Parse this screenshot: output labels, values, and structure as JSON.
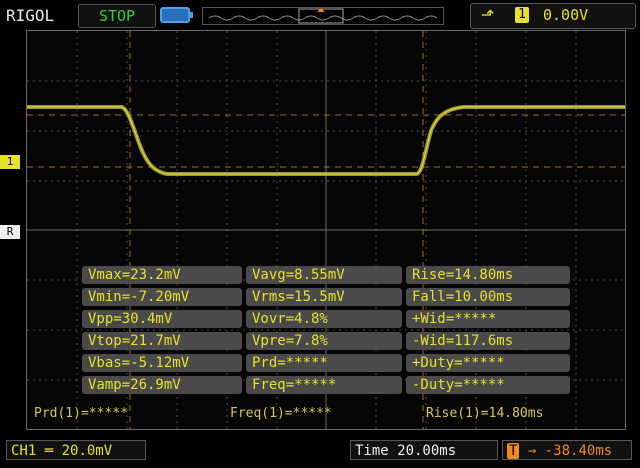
{
  "header": {
    "brand": "RIGOL",
    "run_status": "STOP",
    "trigger_edge_icon": "rising-edge-icon",
    "trigger_source": "1",
    "trigger_level": "0.00V"
  },
  "markers": {
    "channel1": "1",
    "reference": "R",
    "trigger": "T"
  },
  "measurements": [
    [
      "Vmax=23.2mV",
      "Vavg=8.55mV",
      "Rise=14.80ms"
    ],
    [
      "Vmin=-7.20mV",
      "Vrms=15.5mV",
      "Fall=10.00ms"
    ],
    [
      "Vpp=30.4mV",
      "Vovr=4.8%",
      "+Wid=*****"
    ],
    [
      "Vtop=21.7mV",
      "Vpre=7.8%",
      "-Wid=117.6ms"
    ],
    [
      "Vbas=-5.12mV",
      "Prd=*****",
      "+Duty=*****"
    ],
    [
      "Vamp=26.9mV",
      "Freq=*****",
      "-Duty=*****"
    ]
  ],
  "footer_measurements": {
    "period": "Prd(1)=*****",
    "frequency": "Freq(1)=*****",
    "rise": "Rise(1)=14.80ms"
  },
  "bottom": {
    "channel_label": "CH1",
    "channel_scale": "20.0mV",
    "timebase": "Time 20.00ms",
    "trigger_icon": "T",
    "horizontal_offset": "-38.40ms"
  },
  "colors": {
    "trace": "#b9b02a",
    "channel1": "#e8e02a",
    "trigger": "#f08a20",
    "grid": "#6a6a6a"
  }
}
